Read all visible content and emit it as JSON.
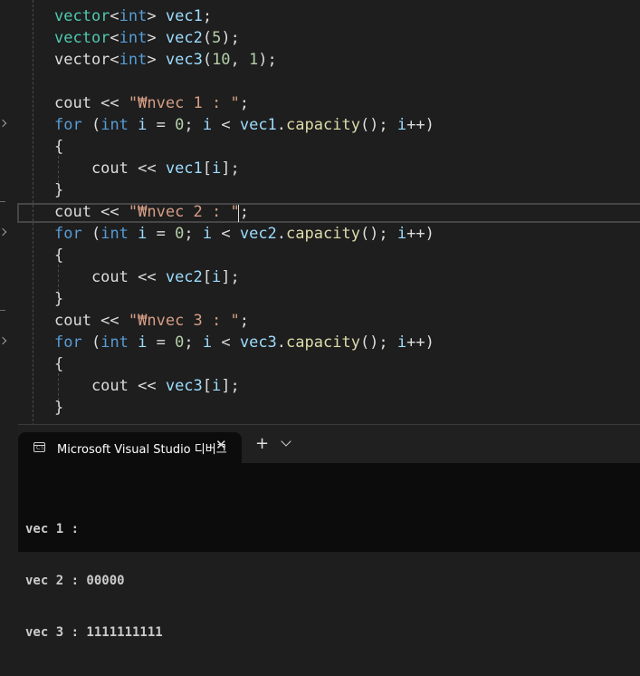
{
  "editor": {
    "lines": [
      {
        "segments": [
          {
            "t": "cls",
            "v": "vector"
          },
          {
            "t": "plain",
            "v": "<"
          },
          {
            "t": "kw",
            "v": "int"
          },
          {
            "t": "plain",
            "v": "> "
          },
          {
            "t": "var",
            "v": "vec1"
          },
          {
            "t": "plain",
            "v": ";"
          }
        ]
      },
      {
        "segments": [
          {
            "t": "cls",
            "v": "vector"
          },
          {
            "t": "plain",
            "v": "<"
          },
          {
            "t": "kw",
            "v": "int"
          },
          {
            "t": "plain",
            "v": "> "
          },
          {
            "t": "var",
            "v": "vec2"
          },
          {
            "t": "plain",
            "v": "("
          },
          {
            "t": "num",
            "v": "5"
          },
          {
            "t": "plain",
            "v": ");"
          }
        ]
      },
      {
        "segments": [
          {
            "t": "plain",
            "v": "vector<"
          },
          {
            "t": "kw",
            "v": "int"
          },
          {
            "t": "plain",
            "v": "> "
          },
          {
            "t": "var",
            "v": "vec3"
          },
          {
            "t": "plain",
            "v": "("
          },
          {
            "t": "num",
            "v": "10"
          },
          {
            "t": "plain",
            "v": ", "
          },
          {
            "t": "num",
            "v": "1"
          },
          {
            "t": "plain",
            "v": ");"
          }
        ]
      },
      {
        "segments": []
      },
      {
        "segments": [
          {
            "t": "plain",
            "v": "cout << "
          },
          {
            "t": "str",
            "v": "\"₩nvec 1 : \""
          },
          {
            "t": "plain",
            "v": ";"
          }
        ]
      },
      {
        "segments": [
          {
            "t": "kw",
            "v": "for"
          },
          {
            "t": "plain",
            "v": " ("
          },
          {
            "t": "kw",
            "v": "int"
          },
          {
            "t": "plain",
            "v": " "
          },
          {
            "t": "var",
            "v": "i"
          },
          {
            "t": "plain",
            "v": " = "
          },
          {
            "t": "num",
            "v": "0"
          },
          {
            "t": "plain",
            "v": "; "
          },
          {
            "t": "var",
            "v": "i"
          },
          {
            "t": "plain",
            "v": " < "
          },
          {
            "t": "var",
            "v": "vec1"
          },
          {
            "t": "plain",
            "v": "."
          },
          {
            "t": "fn",
            "v": "capacity"
          },
          {
            "t": "plain",
            "v": "(); "
          },
          {
            "t": "var",
            "v": "i"
          },
          {
            "t": "plain",
            "v": "++)"
          }
        ]
      },
      {
        "segments": [
          {
            "t": "plain",
            "v": "{"
          }
        ]
      },
      {
        "segments": [
          {
            "t": "plain",
            "v": "    cout << "
          },
          {
            "t": "var",
            "v": "vec1"
          },
          {
            "t": "plain",
            "v": "["
          },
          {
            "t": "var",
            "v": "i"
          },
          {
            "t": "plain",
            "v": "];"
          }
        ]
      },
      {
        "segments": [
          {
            "t": "plain",
            "v": "}"
          }
        ]
      },
      {
        "segments": [
          {
            "t": "plain",
            "v": "cout << "
          },
          {
            "t": "str",
            "v": "\"₩nvec 2 : \""
          },
          {
            "t": "plain",
            "v": ";"
          }
        ]
      },
      {
        "segments": [
          {
            "t": "kw",
            "v": "for"
          },
          {
            "t": "plain",
            "v": " ("
          },
          {
            "t": "kw",
            "v": "int"
          },
          {
            "t": "plain",
            "v": " "
          },
          {
            "t": "var",
            "v": "i"
          },
          {
            "t": "plain",
            "v": " = "
          },
          {
            "t": "num",
            "v": "0"
          },
          {
            "t": "plain",
            "v": "; "
          },
          {
            "t": "var",
            "v": "i"
          },
          {
            "t": "plain",
            "v": " < "
          },
          {
            "t": "var",
            "v": "vec2"
          },
          {
            "t": "plain",
            "v": "."
          },
          {
            "t": "fn",
            "v": "capacity"
          },
          {
            "t": "plain",
            "v": "(); "
          },
          {
            "t": "var",
            "v": "i"
          },
          {
            "t": "plain",
            "v": "++)"
          }
        ]
      },
      {
        "segments": [
          {
            "t": "plain",
            "v": "{"
          }
        ]
      },
      {
        "segments": [
          {
            "t": "plain",
            "v": "    cout << "
          },
          {
            "t": "var",
            "v": "vec2"
          },
          {
            "t": "plain",
            "v": "["
          },
          {
            "t": "var",
            "v": "i"
          },
          {
            "t": "plain",
            "v": "];"
          }
        ]
      },
      {
        "segments": [
          {
            "t": "plain",
            "v": "}"
          }
        ]
      },
      {
        "segments": [
          {
            "t": "plain",
            "v": "cout << "
          },
          {
            "t": "str",
            "v": "\"₩nvec 3 : \""
          },
          {
            "t": "plain",
            "v": ";"
          }
        ]
      },
      {
        "segments": [
          {
            "t": "kw",
            "v": "for"
          },
          {
            "t": "plain",
            "v": " ("
          },
          {
            "t": "kw",
            "v": "int"
          },
          {
            "t": "plain",
            "v": " "
          },
          {
            "t": "var",
            "v": "i"
          },
          {
            "t": "plain",
            "v": " = "
          },
          {
            "t": "num",
            "v": "0"
          },
          {
            "t": "plain",
            "v": "; "
          },
          {
            "t": "var",
            "v": "i"
          },
          {
            "t": "plain",
            "v": " < "
          },
          {
            "t": "var",
            "v": "vec3"
          },
          {
            "t": "plain",
            "v": "."
          },
          {
            "t": "fn",
            "v": "capacity"
          },
          {
            "t": "plain",
            "v": "(); "
          },
          {
            "t": "var",
            "v": "i"
          },
          {
            "t": "plain",
            "v": "++)"
          }
        ]
      },
      {
        "segments": [
          {
            "t": "plain",
            "v": "{"
          }
        ]
      },
      {
        "segments": [
          {
            "t": "plain",
            "v": "    cout << "
          },
          {
            "t": "var",
            "v": "vec3"
          },
          {
            "t": "plain",
            "v": "["
          },
          {
            "t": "var",
            "v": "i"
          },
          {
            "t": "plain",
            "v": "];"
          }
        ]
      },
      {
        "segments": [
          {
            "t": "plain",
            "v": "}"
          }
        ]
      }
    ]
  },
  "terminal": {
    "tab_title": "Microsoft Visual Studio 디버그",
    "tab_icon_text": "C:\\",
    "close_glyph": "✕",
    "new_tab_glyph": "+",
    "output": [
      "vec 1 :",
      "vec 2 : 00000",
      "vec 3 : 1111111111"
    ]
  },
  "colors": {
    "keyword": "#569cd6",
    "string": "#d69d85",
    "variable": "#9cdcfe",
    "function": "#dcdcaa",
    "type": "#4ec9b0",
    "number": "#b5cea8",
    "text": "#dcdcdc",
    "editor_bg": "#1e1e1e",
    "terminal_bg": "#0c0c0c"
  }
}
